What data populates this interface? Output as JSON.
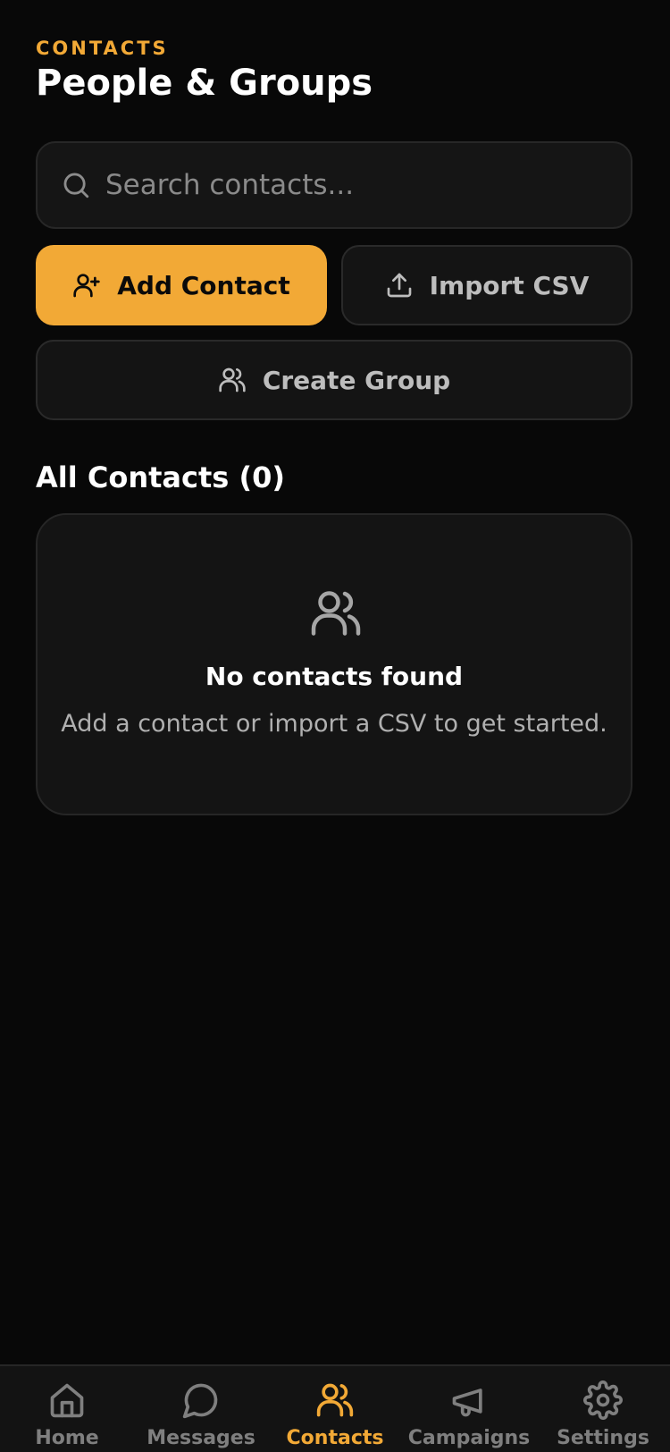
{
  "header": {
    "eyebrow": "CONTACTS",
    "title": "People & Groups"
  },
  "search": {
    "placeholder": "Search contacts...",
    "value": "",
    "icon": "search-icon"
  },
  "actions": {
    "add_contact": {
      "label": "Add Contact",
      "icon": "user-plus-icon"
    },
    "import_csv": {
      "label": "Import CSV",
      "icon": "upload-icon"
    },
    "create_group": {
      "label": "Create Group",
      "icon": "users-icon"
    }
  },
  "contacts": {
    "heading": "All Contacts (0)",
    "items": [],
    "empty": {
      "icon": "users-icon",
      "title": "No contacts found",
      "message": "Add a contact or import a CSV to get started."
    }
  },
  "nav": {
    "items": [
      {
        "label": "Home",
        "icon": "home-icon",
        "active": false
      },
      {
        "label": "Messages",
        "icon": "message-circle-icon",
        "active": false
      },
      {
        "label": "Contacts",
        "icon": "users-icon",
        "active": true
      },
      {
        "label": "Campaigns",
        "icon": "megaphone-icon",
        "active": false
      },
      {
        "label": "Settings",
        "icon": "gear-icon",
        "active": false
      }
    ]
  },
  "colors": {
    "background": "#080808",
    "surface": "#141414",
    "accent": "#f2a936",
    "muted_text": "#b0b0b0",
    "inactive_nav": "#7f7f7f"
  }
}
